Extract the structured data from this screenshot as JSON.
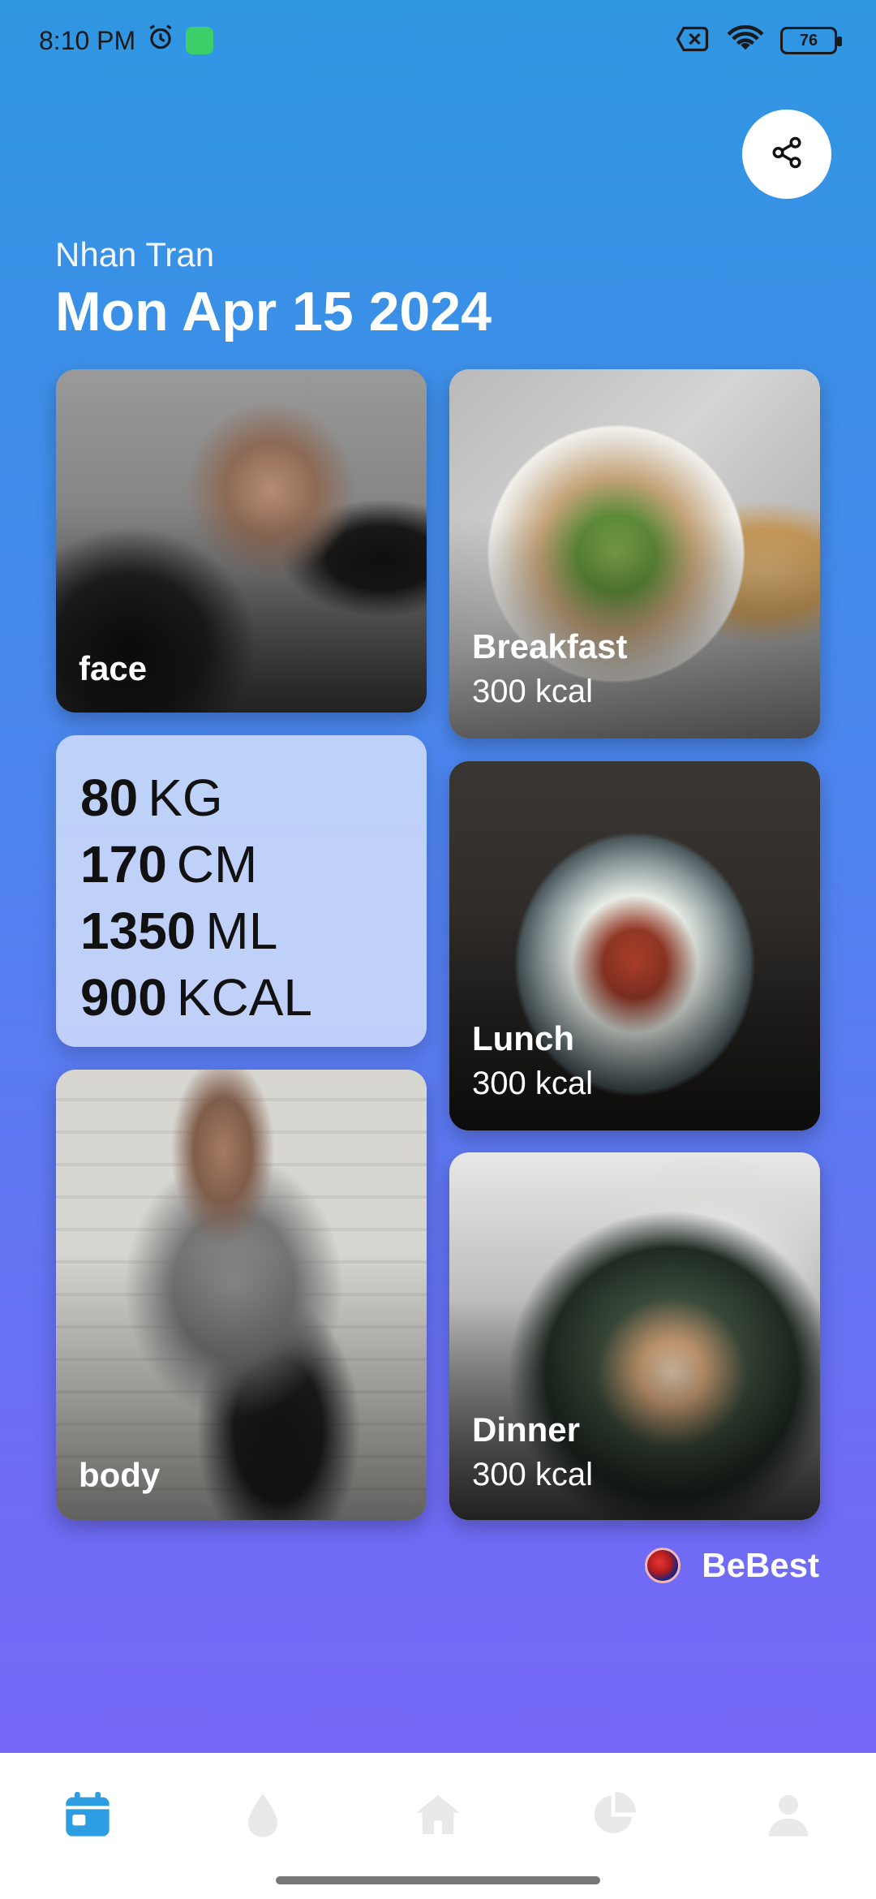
{
  "status_bar": {
    "time": "8:10 PM",
    "battery": "76",
    "icons": [
      "alarm-icon",
      "app-badge-icon",
      "no-sim-icon",
      "wifi-icon",
      "battery-icon"
    ]
  },
  "header": {
    "user_name": "Nhan Tran",
    "date": "Mon Apr 15 2024"
  },
  "cards": {
    "face": {
      "title": "face"
    },
    "body": {
      "title": "body"
    },
    "breakfast": {
      "title": "Breakfast",
      "calories": "300 kcal"
    },
    "lunch": {
      "title": "Lunch",
      "calories": "300 kcal"
    },
    "dinner": {
      "title": "Dinner",
      "calories": "300 kcal"
    }
  },
  "stats": [
    {
      "value": "80",
      "unit": "KG"
    },
    {
      "value": "170",
      "unit": "CM"
    },
    {
      "value": "1350",
      "unit": "ML"
    },
    {
      "value": "900",
      "unit": "KCAL"
    }
  ],
  "brand": {
    "name": "BeBest"
  },
  "nav": {
    "items": [
      "calendar-icon",
      "water-drop-icon",
      "home-icon",
      "pie-chart-icon",
      "profile-icon"
    ],
    "active": "calendar-icon",
    "active_color": "#2d9ee3",
    "inactive_color": "#e9e9e9"
  }
}
